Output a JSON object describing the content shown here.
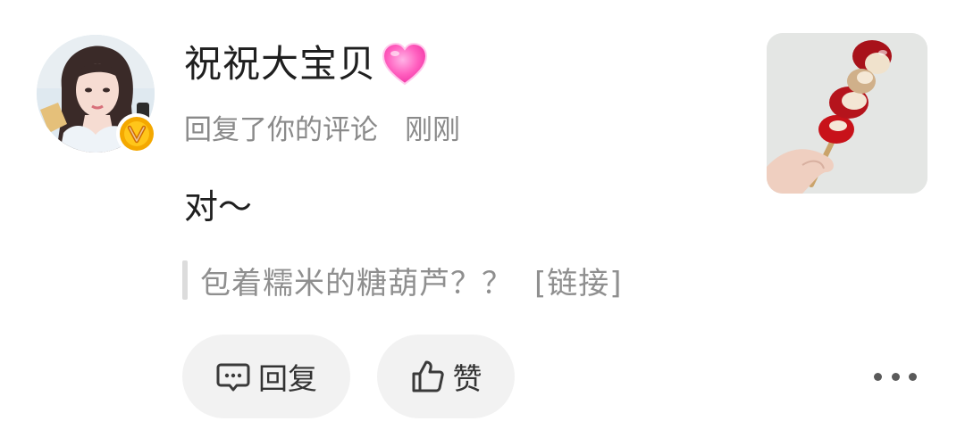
{
  "comment": {
    "author_name": "祝祝大宝贝",
    "author_decoration_icon": "pink-heart-icon",
    "action_text": "回复了你的评论",
    "time": "刚刚",
    "content": "对～",
    "quoted_text": "包着糯米的糖葫芦？？",
    "quoted_link": "[链接]",
    "verified_badge_icon": "verified-v-badge-icon"
  },
  "actions": {
    "reply_label": "回复",
    "reply_icon": "comment-bubble-icon",
    "like_label": "赞",
    "like_icon": "thumbs-up-icon",
    "more_icon": "more-dots-icon"
  },
  "colors": {
    "name": "#1f1f1f",
    "meta": "#8a8a8a",
    "quote": "#8f8f8f",
    "button_bg": "#f2f2f2",
    "badge": "#f4a800",
    "heart": "#ff5fbf"
  }
}
